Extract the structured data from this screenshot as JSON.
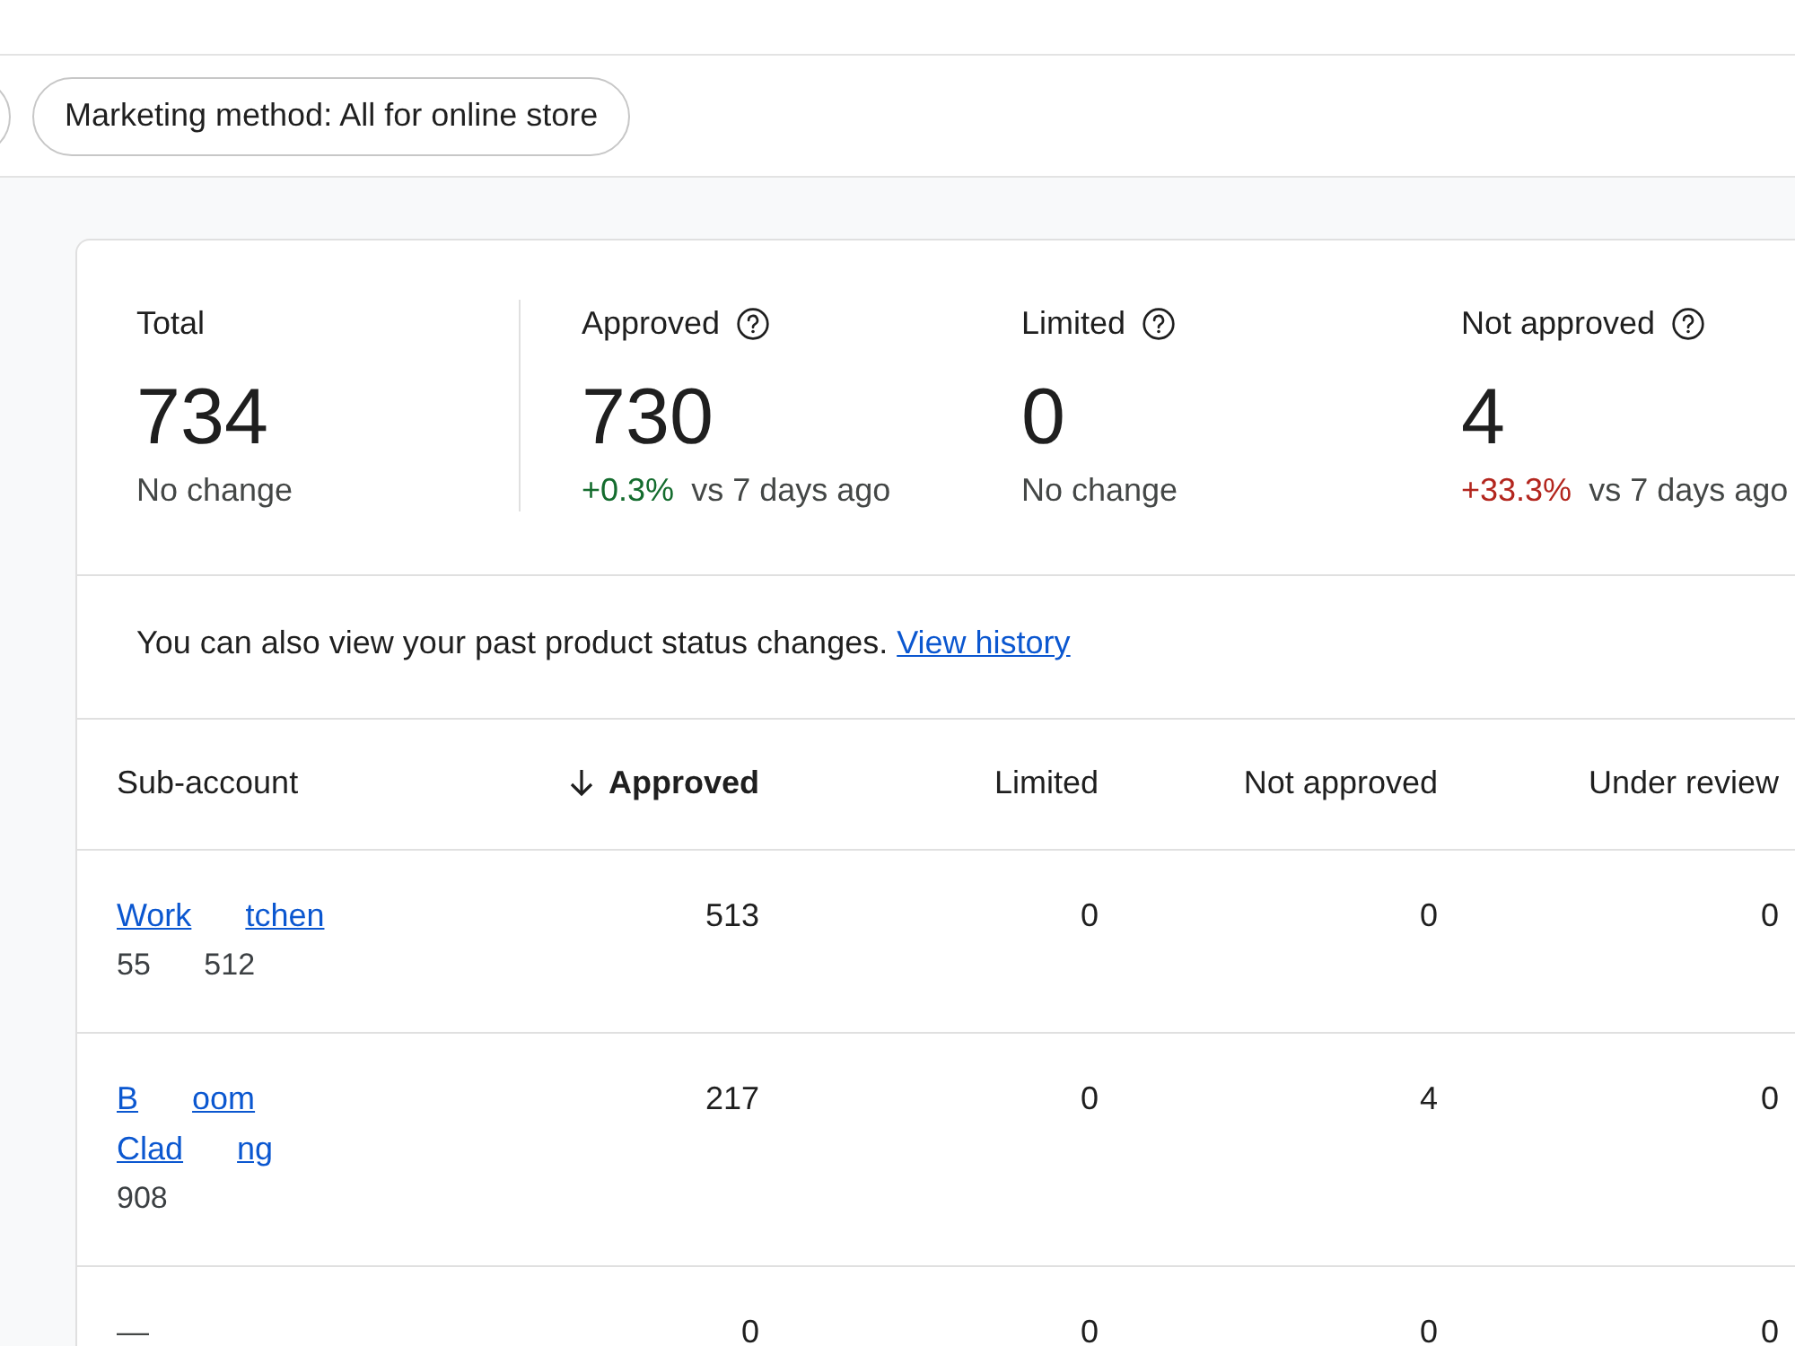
{
  "filters": [
    {
      "label": "Marketing method: All for online store"
    }
  ],
  "summary": [
    {
      "label": "Total",
      "help": false,
      "value": "734",
      "note": "No change"
    },
    {
      "label": "Approved",
      "help": true,
      "value": "730",
      "change": {
        "text": "+0.3%",
        "color": "#146c2e"
      },
      "note": "vs 7 days ago"
    },
    {
      "label": "Limited",
      "help": true,
      "value": "0",
      "note": "No change"
    },
    {
      "label": "Not approved",
      "help": true,
      "value": "4",
      "change": {
        "text": "+33.3%",
        "color": "#b3261e"
      },
      "note": "vs 7 days ago"
    }
  ],
  "history_note": {
    "text": "You can also view your past product status changes.",
    "link": "View history"
  },
  "table": {
    "name_header": {
      "label": "Sub-account",
      "sorted": false
    },
    "columns": [
      {
        "label": "Approved",
        "sorted": true
      },
      {
        "label": "Limited",
        "sorted": false
      },
      {
        "label": "Not approved",
        "sorted": false
      },
      {
        "label": "Under review",
        "sorted": false
      }
    ],
    "rows": [
      {
        "linked": true,
        "name": [
          "Work",
          "tchen"
        ],
        "id": [
          "55",
          "512"
        ],
        "cells": [
          "513",
          "0",
          "0",
          "0"
        ]
      },
      {
        "linked": true,
        "name": [
          "B",
          "oom",
          "Clad",
          "ng"
        ],
        "id": [
          "908"
        ],
        "cells": [
          "217",
          "0",
          "4",
          "0"
        ]
      },
      {
        "linked": false,
        "name": [
          "—"
        ],
        "cells": [
          "0",
          "0",
          "0",
          "0"
        ]
      }
    ]
  }
}
